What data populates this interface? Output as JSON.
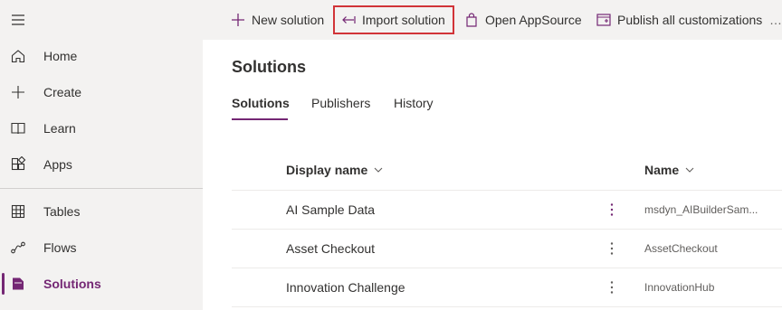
{
  "sidebar": {
    "items": [
      {
        "label": "Home",
        "icon": "home-icon"
      },
      {
        "label": "Create",
        "icon": "plus-icon"
      },
      {
        "label": "Learn",
        "icon": "book-icon"
      },
      {
        "label": "Apps",
        "icon": "apps-icon"
      },
      {
        "label": "Tables",
        "icon": "table-icon"
      },
      {
        "label": "Flows",
        "icon": "flow-icon"
      },
      {
        "label": "Solutions",
        "icon": "solutions-icon"
      }
    ],
    "active": "Solutions"
  },
  "toolbar": {
    "new_solution": "New solution",
    "import_solution": "Import solution",
    "open_appsource": "Open AppSource",
    "publish_all": "Publish all customizations"
  },
  "main": {
    "title": "Solutions",
    "tabs": [
      {
        "label": "Solutions"
      },
      {
        "label": "Publishers"
      },
      {
        "label": "History"
      }
    ],
    "columns": {
      "display_name": "Display name",
      "name": "Name"
    },
    "rows": [
      {
        "display_name": "AI Sample Data",
        "name": "msdyn_AIBuilderSam..."
      },
      {
        "display_name": "Asset Checkout",
        "name": "AssetCheckout"
      },
      {
        "display_name": "Innovation Challenge",
        "name": "InnovationHub"
      }
    ]
  },
  "colors": {
    "accent": "#742774",
    "highlight_border": "#d13438",
    "sidebar_bg": "#f3f2f1"
  }
}
